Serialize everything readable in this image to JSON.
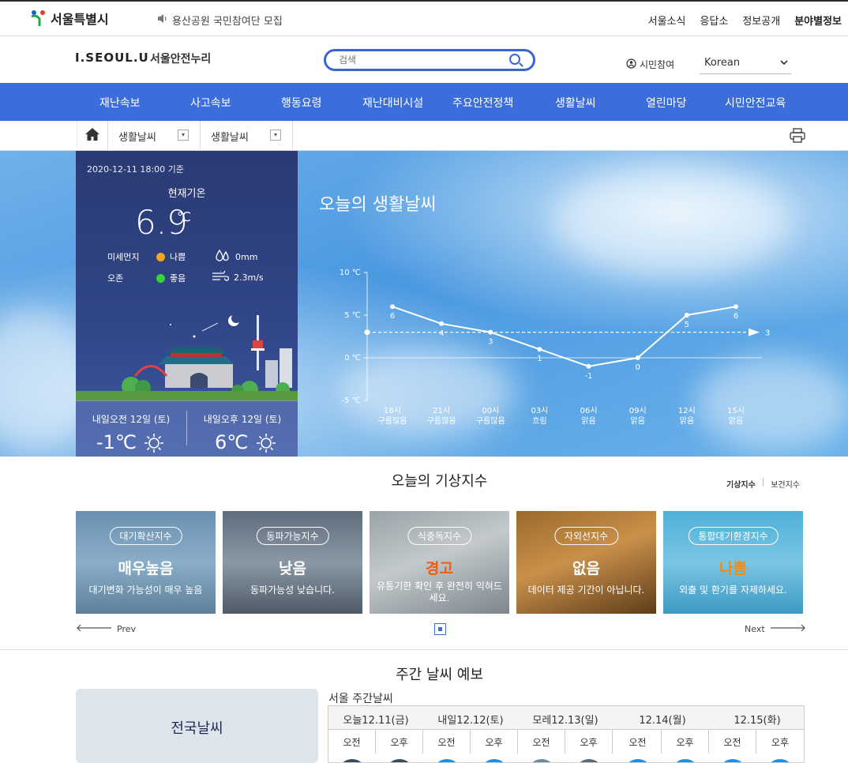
{
  "topbar": {
    "logo_text": "서울특별시",
    "notice": "용산공원 국민참여단 모집",
    "util_links": [
      "서울소식",
      "응답소",
      "정보공개",
      "분야별정보"
    ]
  },
  "header": {
    "brand": "I.SEOUL.U",
    "site_name": "서울안전누리",
    "search_placeholder": "검색",
    "citizen_label": "시민참여",
    "language": "Korean"
  },
  "nav": {
    "items": [
      "재난속보",
      "사고속보",
      "행동요령",
      "재난대비시설",
      "주요안전정책",
      "생활날씨",
      "열린마당",
      "시민안전교육"
    ]
  },
  "breadcrumb": {
    "level1": "생활날씨",
    "level2": "생활날씨"
  },
  "current": {
    "timestamp": "2020-12-11 18:00 기준",
    "label": "현재기온",
    "temp": "6.9",
    "unit": "℃",
    "dust_label": "미세먼지",
    "dust_value": "나쁨",
    "ozone_label": "오존",
    "ozone_value": "좋음",
    "rain": "0mm",
    "wind": "2.3m/s",
    "am_label": "내일오전 12일 (토)",
    "am_temp": "-1℃",
    "pm_label": "내일오후 12일 (토)",
    "pm_temp": "6℃",
    "colors": {
      "dust": "#f2a81d",
      "ozone": "#3ad13a"
    }
  },
  "hero_title": "오늘의 생활날씨",
  "chart_data": {
    "type": "line",
    "categories": [
      "18시",
      "21시",
      "00시",
      "03시",
      "06시",
      "09시",
      "12시",
      "15시"
    ],
    "sub_labels": [
      "구름많음",
      "구름많음",
      "구름많음",
      "흐림",
      "맑음",
      "맑음",
      "맑음",
      "맑음"
    ],
    "values": [
      6,
      4,
      3,
      1,
      -1,
      0,
      5,
      6
    ],
    "reference_value": 3,
    "ylim": [
      -5,
      10
    ],
    "yticks": [
      "10 ℃",
      "5 ℃",
      "0 ℃",
      "-5 ℃"
    ],
    "grid": true,
    "color": "#ffffff"
  },
  "indices": {
    "title": "오늘의 기상지수",
    "tab_active": "기상지수",
    "tab_sep": "|",
    "tab_other": "보건지수",
    "cards": [
      {
        "name": "대기확산지수",
        "level": "매우높음",
        "desc": "대기변화 가능성이 매우 높음",
        "level_color": "#ffffff"
      },
      {
        "name": "동파가능지수",
        "level": "낮음",
        "desc": "동파가능성 낮습니다.",
        "level_color": "#ffffff"
      },
      {
        "name": "식중독지수",
        "level": "경고",
        "desc": "유통기한 확인 후 완전히 익혀드세요.",
        "level_color": "#f05a12"
      },
      {
        "name": "자외선지수",
        "level": "없음",
        "desc": "데이터 제공 기간이 아닙니다.",
        "level_color": "#ffffff"
      },
      {
        "name": "통합대기환경지수",
        "level": "나쁨",
        "desc": "외출 및 환기를 자제하세요.",
        "level_color": "#f58a12"
      }
    ],
    "prev": "Prev",
    "next": "Next"
  },
  "weekly": {
    "title": "주간 날씨 예보",
    "national": "전국날씨",
    "seoul_label": "서울 주간날씨",
    "days": [
      "오늘12.11(금)",
      "내일12.12(토)",
      "모레12.13(일)",
      "12.14(월)",
      "12.15(화)"
    ],
    "am": "오전",
    "pm": "오후",
    "icon_colors": [
      "#3a4a5a",
      "#3a4a5a",
      "#1e8fe0",
      "#1e8fe0",
      "#6a8aa0",
      "#5a6a78",
      "#1e8fe0",
      "#1e8fe0",
      "#1e8fe0",
      "#1e8fe0"
    ]
  }
}
